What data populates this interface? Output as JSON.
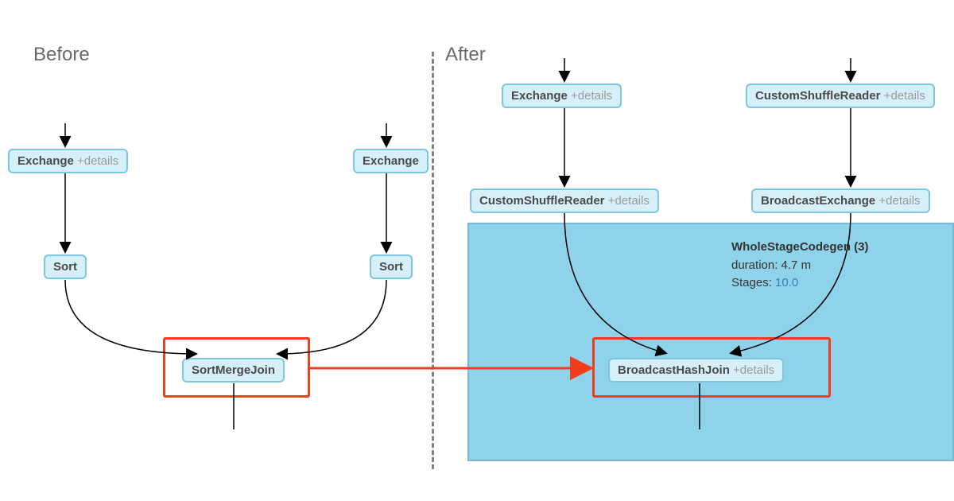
{
  "before": {
    "title": "Before",
    "nodes": {
      "exchange1": {
        "label": "Exchange",
        "details": "+details"
      },
      "exchange2": {
        "label": "Exchange"
      },
      "sort1": {
        "label": "Sort"
      },
      "sort2": {
        "label": "Sort"
      },
      "join": {
        "label": "SortMergeJoin"
      }
    }
  },
  "after": {
    "title": "After",
    "codegen": {
      "title": "WholeStageCodegen (3)",
      "duration_label": "duration: ",
      "duration_value": "4.7 m",
      "stages_label": "Stages: ",
      "stages_value": "10.0"
    },
    "nodes": {
      "exchange": {
        "label": "Exchange",
        "details": "+details"
      },
      "csr1": {
        "label": "CustomShuffleReader",
        "details": "+details"
      },
      "csr2": {
        "label": "CustomShuffleReader",
        "details": "+details"
      },
      "bexchange": {
        "label": "BroadcastExchange",
        "details": "+details"
      },
      "join": {
        "label": "BroadcastHashJoin",
        "details": "+details"
      }
    }
  }
}
